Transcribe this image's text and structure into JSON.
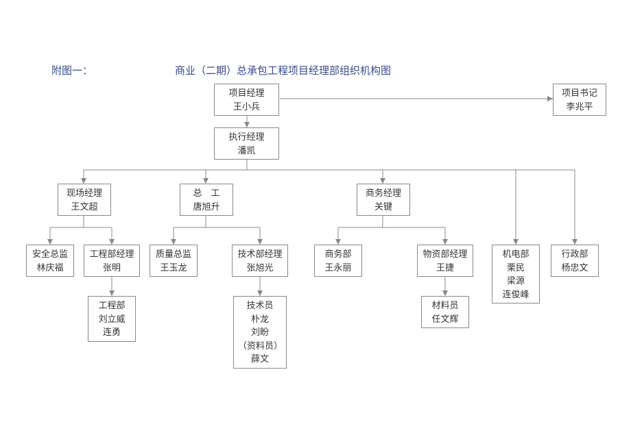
{
  "header": {
    "label": "附图一：",
    "title": "商业（二期）总承包工程项目经理部组织机构图"
  },
  "boxes": {
    "pm": {
      "role": "项目经理",
      "name": "王小兵"
    },
    "secretary": {
      "role": "项目书记",
      "name": "李兆平"
    },
    "exec": {
      "role": "执行经理",
      "name": "潘凯"
    },
    "site_mgr": {
      "role": "现场经理",
      "name": "王文超"
    },
    "chief_eng": {
      "role": "总　工",
      "name": "唐旭升"
    },
    "biz_mgr": {
      "role": "商务经理",
      "name": "关键"
    },
    "safety": {
      "role": "安全总监",
      "name": "林庆福"
    },
    "eng_mgr": {
      "role": "工程部经理",
      "name": "张明"
    },
    "quality": {
      "role": "质量总监",
      "name": "王玉龙"
    },
    "tech_mgr": {
      "role": "技术部经理",
      "name": "张旭光"
    },
    "biz_dept": {
      "role": "商务部",
      "name": "王永丽"
    },
    "material_mgr": {
      "role": "物资部经理",
      "name": "王捷"
    },
    "me_dept": {
      "role": "机电部",
      "n1": "栗民",
      "n2": "梁源",
      "n3": "连俊峰"
    },
    "admin": {
      "role": "行政部",
      "name": "杨忠文"
    },
    "eng_dept": {
      "role": "工程部",
      "n1": "刘立威",
      "n2": "连勇"
    },
    "tech_staff": {
      "role": "技术员",
      "n1": "朴龙",
      "n2": "刘盼",
      "n3": "（资料员）",
      "n4": "薛文"
    },
    "material_staff": {
      "role": "材料员",
      "name": "任文辉"
    }
  }
}
